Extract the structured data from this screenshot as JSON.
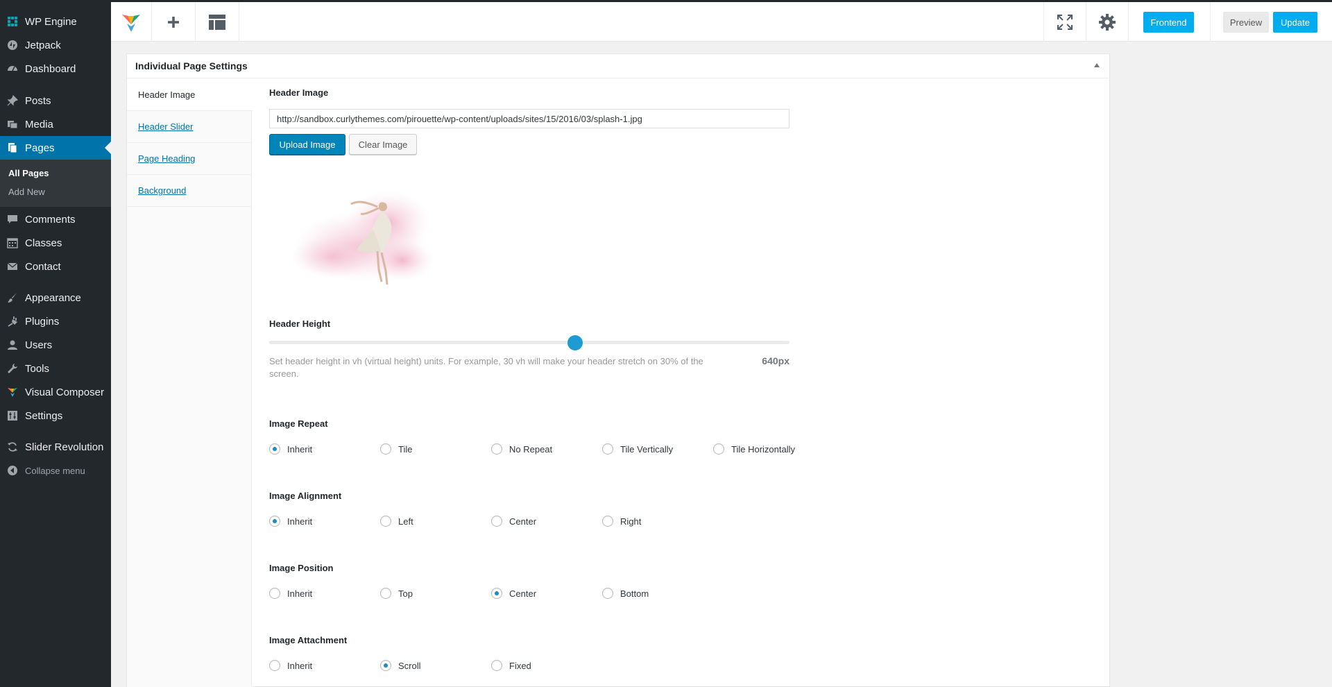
{
  "sidebar": {
    "items": [
      {
        "label": "WP Engine",
        "icon": "wpengine-icon"
      },
      {
        "label": "Jetpack",
        "icon": "jetpack-icon"
      },
      {
        "label": "Dashboard",
        "icon": "dashboard-icon"
      },
      {
        "label": "Posts",
        "icon": "pin-icon"
      },
      {
        "label": "Media",
        "icon": "media-icon"
      },
      {
        "label": "Pages",
        "icon": "pages-icon"
      },
      {
        "label": "Comments",
        "icon": "comment-icon"
      },
      {
        "label": "Classes",
        "icon": "calendar-icon"
      },
      {
        "label": "Contact",
        "icon": "mail-icon"
      },
      {
        "label": "Appearance",
        "icon": "brush-icon"
      },
      {
        "label": "Plugins",
        "icon": "plug-icon"
      },
      {
        "label": "Users",
        "icon": "user-icon"
      },
      {
        "label": "Tools",
        "icon": "wrench-icon"
      },
      {
        "label": "Visual Composer",
        "icon": "vc-logo-icon"
      },
      {
        "label": "Settings",
        "icon": "settings-icon"
      },
      {
        "label": "Slider Revolution",
        "icon": "refresh-icon"
      }
    ],
    "submenu": [
      "All Pages",
      "Add New"
    ],
    "collapse_label": "Collapse menu",
    "active_color": "#0073aa"
  },
  "toolbar": {
    "frontend_label": "Frontend",
    "preview_label": "Preview",
    "update_label": "Update",
    "accent": "#00aeef"
  },
  "panel": {
    "title": "Individual Page Settings",
    "tabs": [
      "Header Image",
      "Header Slider",
      "Page Heading",
      "Background"
    ]
  },
  "header_image": {
    "label": "Header Image",
    "url": "http://sandbox.curlythemes.com/pirouette/wp-content/uploads/sites/15/2016/03/splash-1.jpg",
    "upload_label": "Upload Image",
    "clear_label": "Clear Image"
  },
  "header_height": {
    "label": "Header Height",
    "help": "Set header height in vh (virtual height) units. For example, 30 vh will make your header stretch on 30% of the screen.",
    "value_text": "640px",
    "slider_fraction": 0.59
  },
  "image_repeat": {
    "label": "Image Repeat",
    "options": [
      "Inherit",
      "Tile",
      "No Repeat",
      "Tile Vertically",
      "Tile Horizontally"
    ],
    "selected": "Inherit"
  },
  "image_alignment": {
    "label": "Image Alignment",
    "options": [
      "Inherit",
      "Left",
      "Center",
      "Right"
    ],
    "selected": "Inherit"
  },
  "image_position": {
    "label": "Image Position",
    "options": [
      "Inherit",
      "Top",
      "Center",
      "Bottom"
    ],
    "selected": "Center"
  },
  "image_attachment": {
    "label": "Image Attachment",
    "options": [
      "Inherit",
      "Scroll",
      "Fixed"
    ],
    "selected": "Scroll"
  }
}
